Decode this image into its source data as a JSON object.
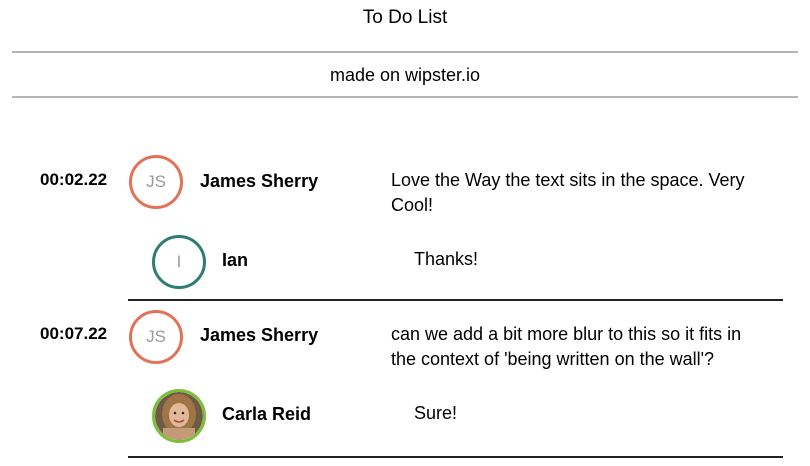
{
  "header": {
    "title": "To Do List",
    "subtitle": "made on wipster.io"
  },
  "colors": {
    "avatar_orange": "#e27258",
    "avatar_teal": "#2e7d72",
    "avatar_green": "#7bbf3a"
  },
  "comments": [
    {
      "timestamp": "00:02.22",
      "author": "James Sherry",
      "initials": "JS",
      "text": "Love the Way the text sits in the space. Very Cool!",
      "reply": {
        "author": "Ian",
        "initials": "I",
        "text": "Thanks!"
      }
    },
    {
      "timestamp": "00:07.22",
      "author": "James Sherry",
      "initials": "JS",
      "text": "can we add a bit more blur to this so it fits in the context of 'being written on the wall'?",
      "reply": {
        "author": "Carla Reid",
        "avatar_type": "photo",
        "text": "Sure!"
      }
    }
  ]
}
